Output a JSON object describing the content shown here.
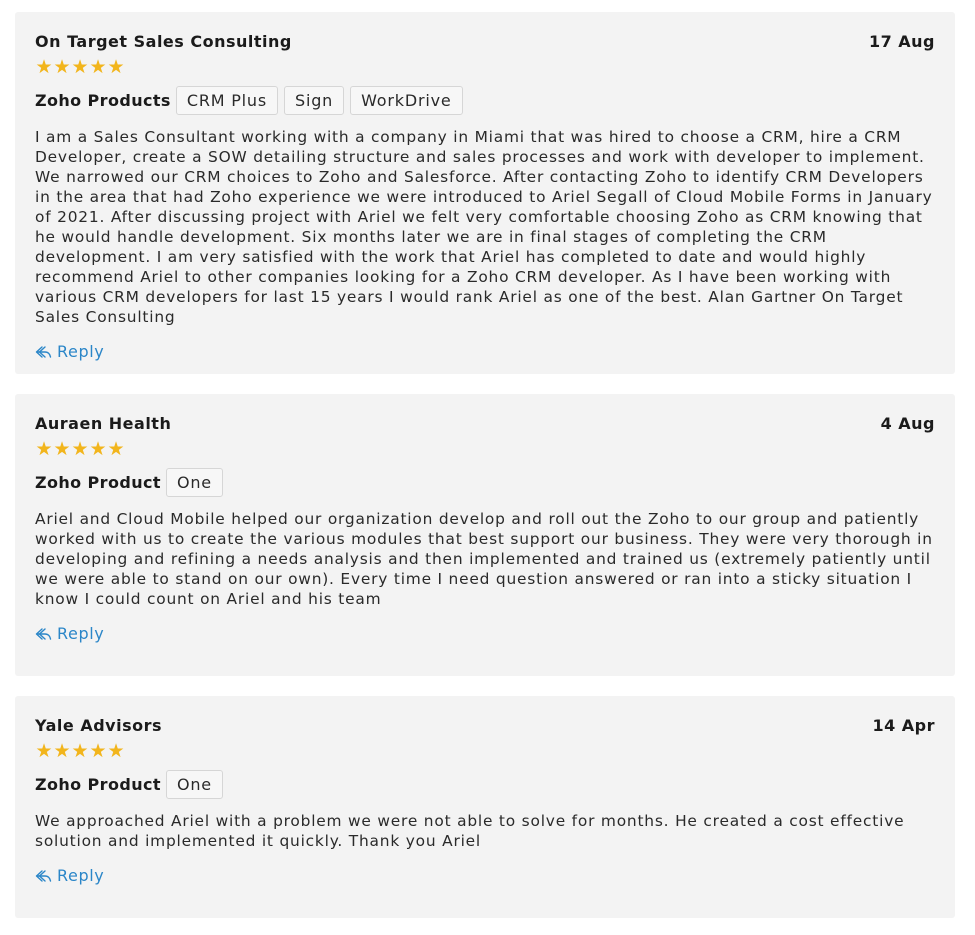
{
  "reviews": [
    {
      "author": "On Target Sales Consulting",
      "date": "17 Aug",
      "stars": "★★★★★",
      "products_label": "Zoho Products",
      "products": [
        "CRM Plus",
        "Sign",
        "WorkDrive"
      ],
      "text": "I am a Sales Consultant working with a company in Miami that was hired to choose a CRM, hire a CRM Developer, create a SOW detailing structure and sales processes and work with developer to implement. We narrowed our CRM choices to Zoho and Salesforce. After contacting Zoho to identify CRM Developers in the area that had Zoho experience we were introduced to Ariel Segall of Cloud Mobile Forms in January of 2021. After discussing project with Ariel we felt very comfortable choosing Zoho as CRM knowing that he would handle development. Six months later we are in final stages of completing the CRM development. I am very satisfied with the work that Ariel has completed to date and would highly recommend Ariel to other companies looking for a Zoho CRM developer. As I have been working with various CRM developers for last 15 years I would rank Ariel as one of the best. Alan Gartner On Target Sales Consulting",
      "reply_label": "Reply"
    },
    {
      "author": "Auraen Health",
      "date": "4 Aug",
      "stars": "★★★★★",
      "products_label": "Zoho Product",
      "products": [
        "One"
      ],
      "text": "Ariel and Cloud Mobile helped our organization develop and roll out the Zoho to our group and patiently worked with us to create the various modules that best support our business. They were very thorough in developing and refining a needs analysis and then implemented and trained us (extremely patiently until we were able to stand on our own). Every time I need question answered or ran into a sticky situation I know I could count on Ariel and his team",
      "reply_label": "Reply"
    },
    {
      "author": "Yale Advisors",
      "date": "14 Apr",
      "stars": "★★★★★",
      "products_label": "Zoho Product",
      "products": [
        "One"
      ],
      "text": "We approached Ariel with a problem we were not able to solve for months. He created a cost effective solution and implemented it quickly. Thank you Ariel",
      "reply_label": "Reply"
    }
  ],
  "colors": {
    "card_bg": "#f3f3f3",
    "star": "#f2b51c",
    "link": "#2b86c8",
    "tag_border": "#d6d6d6"
  },
  "icons": {
    "star": "star-icon",
    "reply": "reply-arrow-icon"
  }
}
